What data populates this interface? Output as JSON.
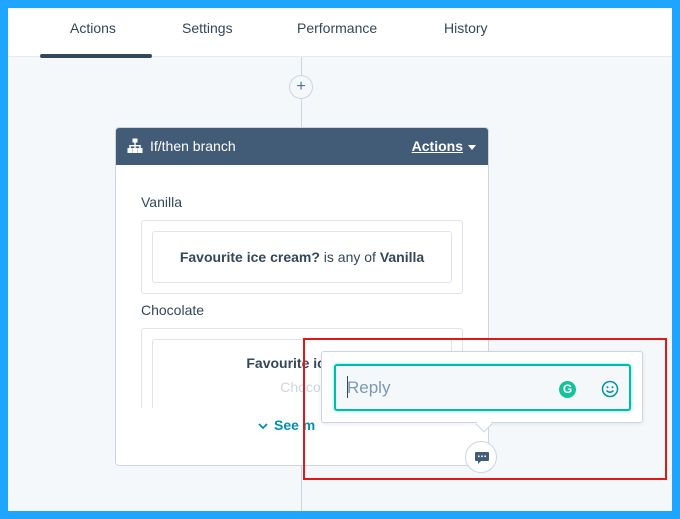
{
  "tabs": [
    {
      "label": "Actions",
      "active": true
    },
    {
      "label": "Settings",
      "active": false
    },
    {
      "label": "Performance",
      "active": false
    },
    {
      "label": "History",
      "active": false
    }
  ],
  "add_step": {
    "icon": "plus-icon",
    "label": "+"
  },
  "branch_card": {
    "icon": "branch-icon",
    "title": "If/then branch",
    "actions_label": "Actions",
    "branches": [
      {
        "label": "Vanilla",
        "property": "Favourite ice cream?",
        "operator": "is any of",
        "value": "Vanilla"
      },
      {
        "label": "Chocolate",
        "property": "Favourite ice cre",
        "value": "Chocol"
      }
    ],
    "see_more_label": "See m"
  },
  "comment_popover": {
    "placeholder": "Reply",
    "grammarly_icon": "grammarly-icon",
    "grammarly_letter": "G",
    "emoji_icon": "smiley-icon"
  },
  "comment_button": {
    "icon": "comment-icon"
  },
  "colors": {
    "background": "#1ea5ff",
    "header": "#425b76",
    "accent": "#00bda5",
    "link": "#0091ae",
    "highlight": "#e01818"
  }
}
